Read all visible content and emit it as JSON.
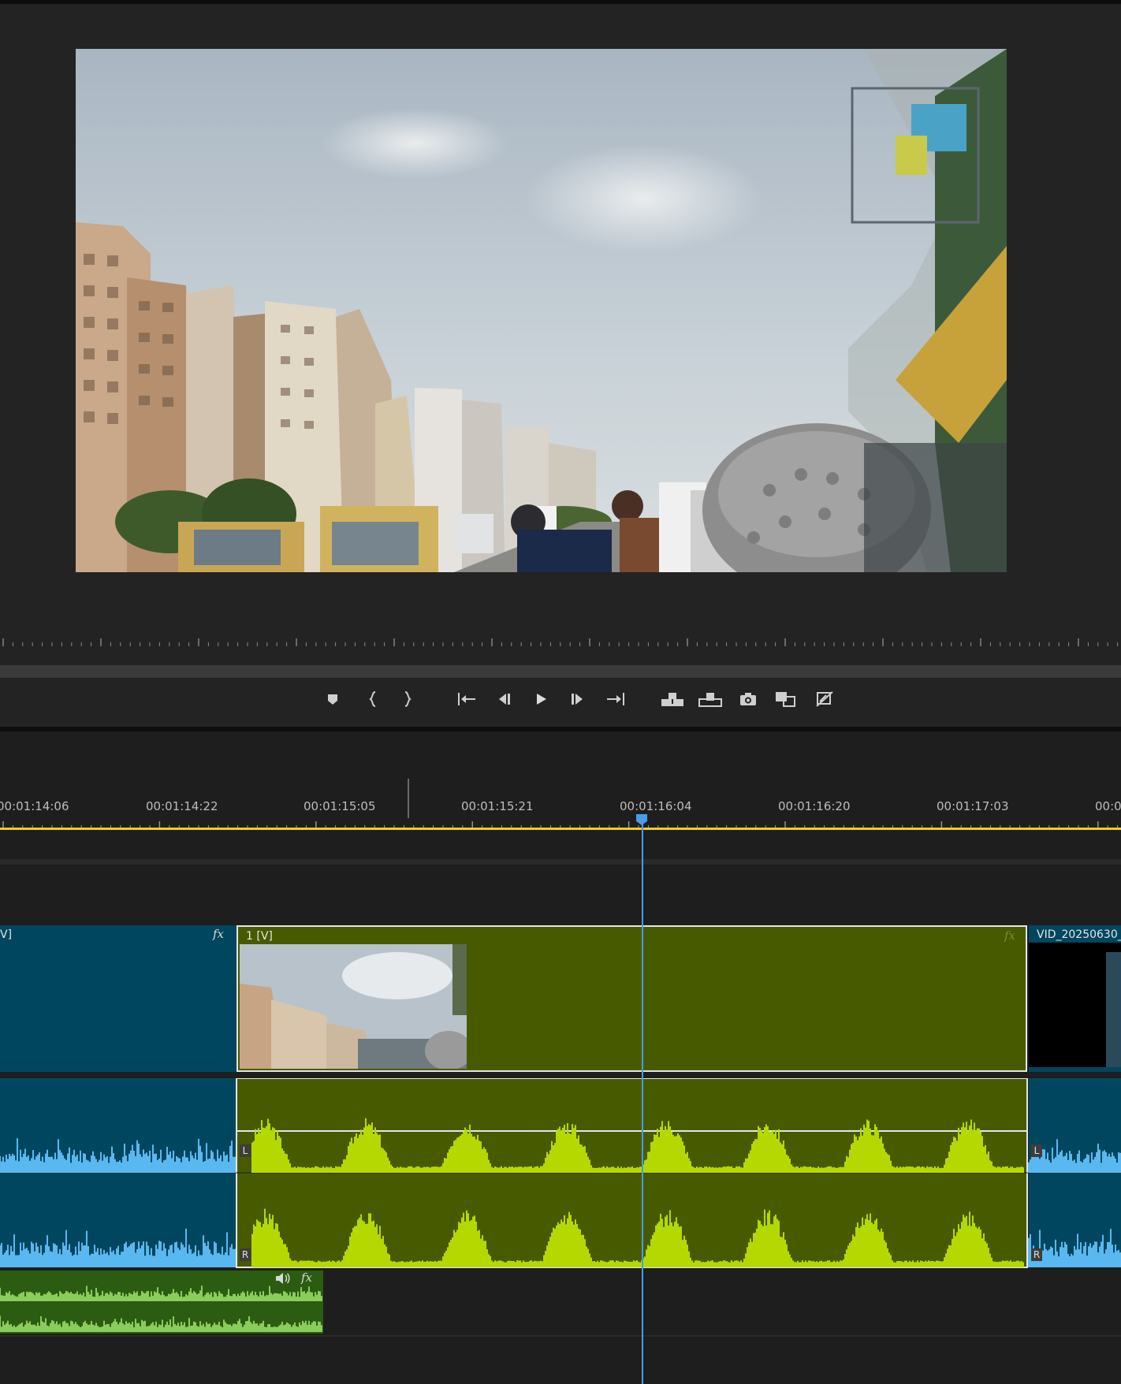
{
  "timeline": {
    "timecodes": [
      "00:01:14:06",
      "00:01:14:22",
      "00:01:15:05",
      "00:01:15:21",
      "00:01:16:04",
      "00:01:16:20",
      "00:01:17:03",
      "00:0"
    ],
    "clips": {
      "left_video_label": "V]",
      "center_video_label": "1 [V]",
      "right_video_label": "VID_20250630_",
      "fx_label": "fx",
      "channel_left": "L",
      "channel_right": "R"
    }
  },
  "colors": {
    "selected_clip": "#485a00",
    "selected_wave": "#b5d900",
    "blue_clip": "#00465f",
    "blue_wave": "#5ab8f0",
    "green_clip": "#2b5c12",
    "green_wave": "#8ccc5c",
    "playhead": "#4a9be8",
    "work_area": "#e8d21d"
  },
  "transport": {
    "icons": [
      "marker-icon",
      "mark-in-icon",
      "mark-out-icon",
      "go-to-in-icon",
      "step-back-icon",
      "play-icon",
      "step-forward-icon",
      "go-to-out-icon",
      "insert-icon",
      "overwrite-icon",
      "export-frame-icon",
      "comparison-view-icon",
      "toggle-proxies-icon"
    ]
  }
}
